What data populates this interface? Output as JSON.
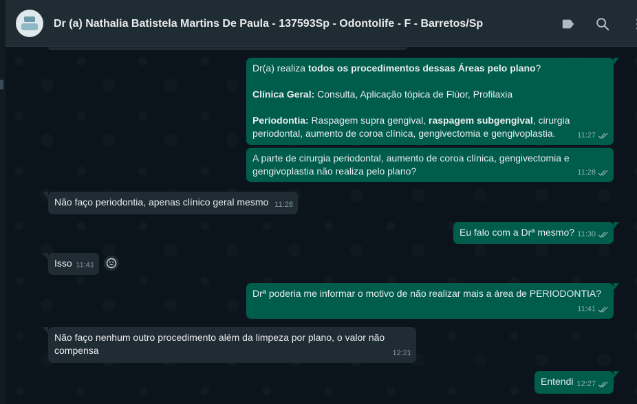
{
  "header": {
    "contact_name": "Dr (a) Nathalia Batistela Martins De Paula - 137593Sp - Odontolife - F - Barretos/Sp"
  },
  "icons": {
    "label": "label-icon",
    "search": "search-icon",
    "menu": "menu-icon",
    "read_receipt": "double-check-icon",
    "emoji": "emoji-icon"
  },
  "colors": {
    "outgoing_bubble": "#005c4b",
    "incoming_bubble": "#202c33",
    "header_bg": "#202c33",
    "chat_bg": "#0b141a"
  },
  "messages": [
    {
      "direction": "out",
      "p1_prefix": "Dr(a) realiza ",
      "p1_bold": "todos os procedimentos dessas Áreas pelo plano",
      "p1_suffix": "?",
      "p2_bold": "Clínica Geral:",
      "p2_rest": " Consulta, Aplicação tópica de Flúor, Profilaxia",
      "p3_bold1": "Periodontia:",
      "p3_mid": " Raspagem supra gengival, ",
      "p3_bold2": "raspagem subgengival",
      "p3_rest": ", cirurgia periodontal, aumento de coroa clínica, gengivectomia e gengivoplastia.",
      "time": "11:27"
    },
    {
      "direction": "out",
      "text": "A parte de  cirurgia periodontal, aumento de coroa clínica, gengivectomia e gengivoplastia não realiza pelo plano?",
      "time": "11:28"
    },
    {
      "direction": "in",
      "text": "Não faço periodontia, apenas clínico geral mesmo",
      "time": "11:28"
    },
    {
      "direction": "out",
      "text": "Eu falo com a Drª mesmo?",
      "time": "11:30"
    },
    {
      "direction": "in",
      "text": "Isso",
      "time": "11:41"
    },
    {
      "direction": "out",
      "text": "Drª poderia me informar o motivo de não realizar mais a área de PERIODONTIA?",
      "time": "11:41"
    },
    {
      "direction": "in",
      "text": "Não faço nenhum outro procedimento além da limpeza por plano, o valor não compensa",
      "time": "12:21"
    },
    {
      "direction": "out",
      "text": "Entendi",
      "time": "12:27"
    }
  ]
}
